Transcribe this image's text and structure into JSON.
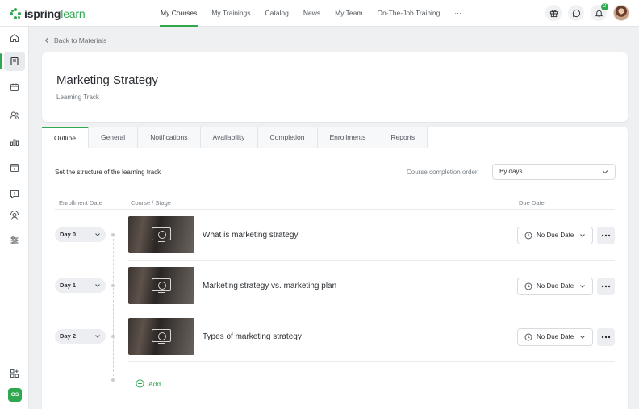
{
  "app": {
    "logo_main": "ispring",
    "logo_sub": "learn"
  },
  "nav": [
    {
      "label": "My Courses",
      "active": true
    },
    {
      "label": "My Trainings"
    },
    {
      "label": "Catalog"
    },
    {
      "label": "News"
    },
    {
      "label": "My Team"
    },
    {
      "label": "On-The-Job Training"
    },
    {
      "label": "···"
    }
  ],
  "topbar": {
    "notification_count": "2",
    "icons": [
      "gift-icon",
      "chat-icon",
      "bell-icon",
      "avatar"
    ]
  },
  "sidebar": {
    "items": [
      "home-icon",
      "book-icon",
      "calendar-icon",
      "users-icon",
      "chart-icon",
      "calendar-day-icon",
      "feedback-icon",
      "user-settings-icon",
      "sliders-icon"
    ],
    "bottom_icon": "apps-add-icon",
    "user_initials": "OS"
  },
  "back_link": "Back to Materials",
  "header": {
    "title": "Marketing Strategy",
    "subtitle": "Learning Track"
  },
  "tabs": [
    {
      "label": "Outline",
      "active": true
    },
    {
      "label": "General"
    },
    {
      "label": "Notifications"
    },
    {
      "label": "Availability"
    },
    {
      "label": "Completion"
    },
    {
      "label": "Enrollments"
    },
    {
      "label": "Reports"
    }
  ],
  "outline": {
    "instruction": "Set the structure of the learning track",
    "order_label": "Course completion order:",
    "order_value": "By days",
    "columns": {
      "enrollment_date": "Enrollment Date",
      "course_stage": "Course / Stage",
      "due_date": "Due Date"
    },
    "rows": [
      {
        "day": "Day 0",
        "title": "What is marketing strategy",
        "due": "No Due Date"
      },
      {
        "day": "Day 1",
        "title": "Marketing strategy vs. marketing plan",
        "due": "No Due Date"
      },
      {
        "day": "Day 2",
        "title": "Types of marketing strategy",
        "due": "No Due Date"
      }
    ],
    "add_label": "Add"
  },
  "colors": {
    "accent": "#2fa84f",
    "text": "#2b2f33",
    "muted": "#7a8187",
    "background": "#eef0f2"
  }
}
